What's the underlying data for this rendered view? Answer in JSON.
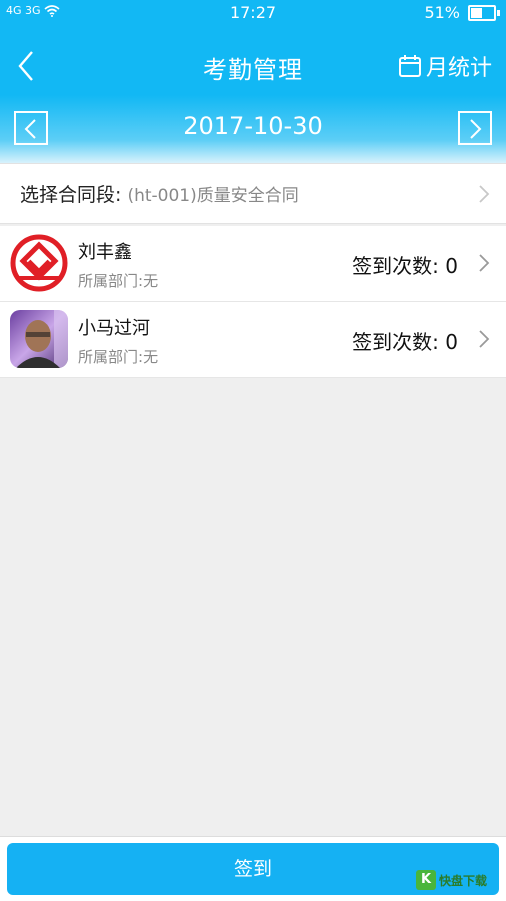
{
  "status_bar": {
    "signal": "4G 3G",
    "time": "17:27",
    "battery": "51%",
    "battery_level": 0.51
  },
  "header": {
    "title": "考勤管理",
    "month_stat_label": "月统计"
  },
  "date_nav": {
    "date": "2017-10-30"
  },
  "contract": {
    "label": "选择合同段:",
    "value": "(ht-001)质量安全合同"
  },
  "members": [
    {
      "name": "刘丰鑫",
      "dept_label": "所属部门:",
      "dept_value": "无",
      "count_label": "签到次数:",
      "count": "0"
    },
    {
      "name": "小马过河",
      "dept_label": "所属部门:",
      "dept_value": "无",
      "count_label": "签到次数:",
      "count": "0"
    }
  ],
  "footer": {
    "signin_label": "签到",
    "watermark": "快盘下载"
  },
  "colors": {
    "primary": "#12b8f4",
    "button": "#15b1f3",
    "background": "#efefef"
  }
}
